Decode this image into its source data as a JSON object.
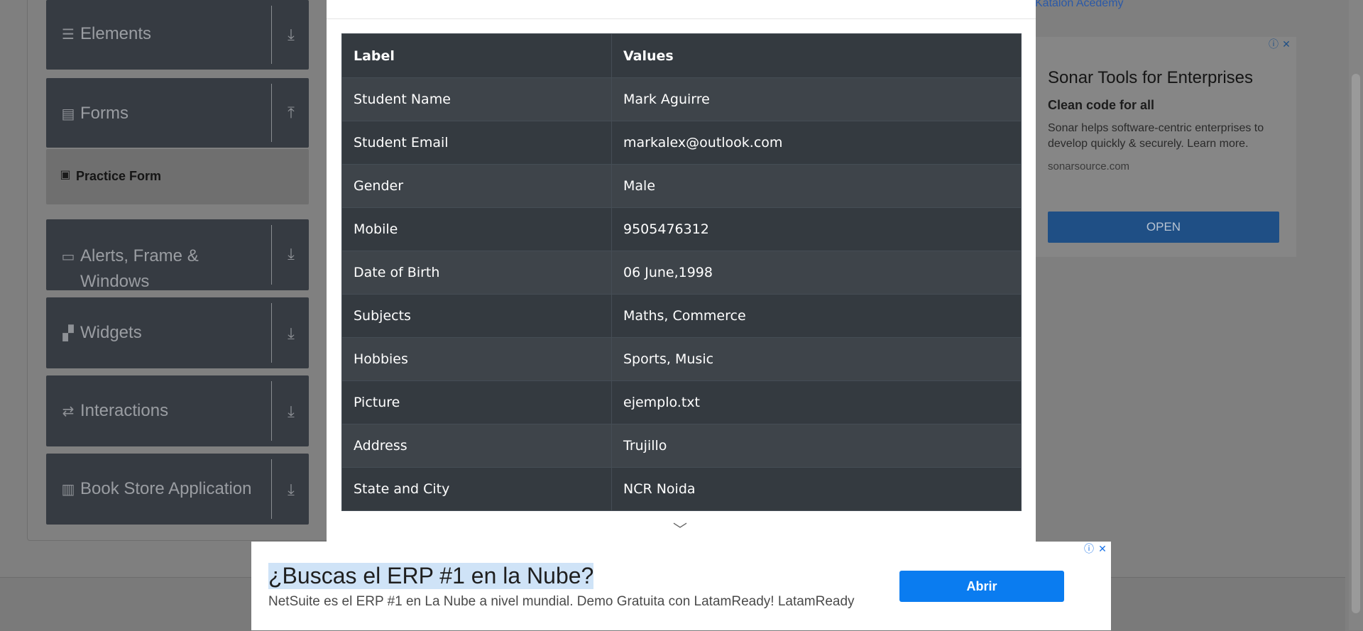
{
  "sidebar": {
    "groups": [
      {
        "label": "Elements",
        "icon": "menu-icon"
      },
      {
        "label": "Forms",
        "icon": "document-icon"
      },
      {
        "label": "Alerts, Frame & Windows",
        "icon": "window-icon"
      },
      {
        "label": "Widgets",
        "icon": "widgets-icon"
      },
      {
        "label": "Interactions",
        "icon": "interactions-icon"
      },
      {
        "label": "Book Store Application",
        "icon": "books-icon"
      }
    ],
    "active_item": "Practice Form"
  },
  "modal": {
    "table": {
      "headers": [
        "Label",
        "Values"
      ],
      "rows": [
        {
          "label": "Student Name",
          "value": "Mark Aguirre"
        },
        {
          "label": "Student Email",
          "value": "markalex@outlook.com"
        },
        {
          "label": "Gender",
          "value": "Male"
        },
        {
          "label": "Mobile",
          "value": "9505476312"
        },
        {
          "label": "Date of Birth",
          "value": "06 June,1998"
        },
        {
          "label": "Subjects",
          "value": "Maths, Commerce"
        },
        {
          "label": "Hobbies",
          "value": "Sports, Music"
        },
        {
          "label": "Picture",
          "value": "ejemplo.txt"
        },
        {
          "label": "Address",
          "value": "Trujillo"
        },
        {
          "label": "State and City",
          "value": "NCR Noida"
        }
      ]
    }
  },
  "right_ad": {
    "image_alt": "Katalon Acedemy",
    "title": "Sonar Tools for Enterprises",
    "subtitle": "Clean code for all",
    "description": "Sonar helps software-centric enterprises to develop quickly & securely. Learn more.",
    "domain": "sonarsource.com",
    "button": "OPEN"
  },
  "bottom_ad": {
    "title": "¿Buscas el ERP #1 en la Nube?",
    "description": "NetSuite es el ERP #1 en La Nube a nivel mundial. Demo Gratuita con LatamReady! LatamReady",
    "button": "Abrir"
  },
  "colors": {
    "overlay": "#7f7f7f",
    "table_dark": "#343a40",
    "table_alt": "#3e444a",
    "ad_button": "#0a7cf0"
  }
}
